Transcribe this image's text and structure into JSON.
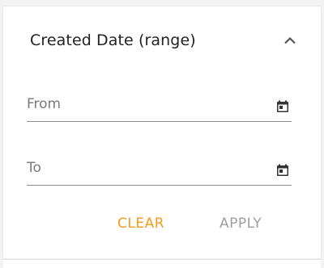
{
  "filter": {
    "title": "Created Date (range)",
    "collapse_icon": "chevron-up-icon",
    "from_placeholder": "From",
    "to_placeholder": "To",
    "calendar_icon": "calendar-icon",
    "clear_label": "CLEAR",
    "apply_label": "APPLY"
  },
  "colors": {
    "accent": "#f59a1b",
    "disabled": "#9e9e9e",
    "text": "#222222"
  }
}
